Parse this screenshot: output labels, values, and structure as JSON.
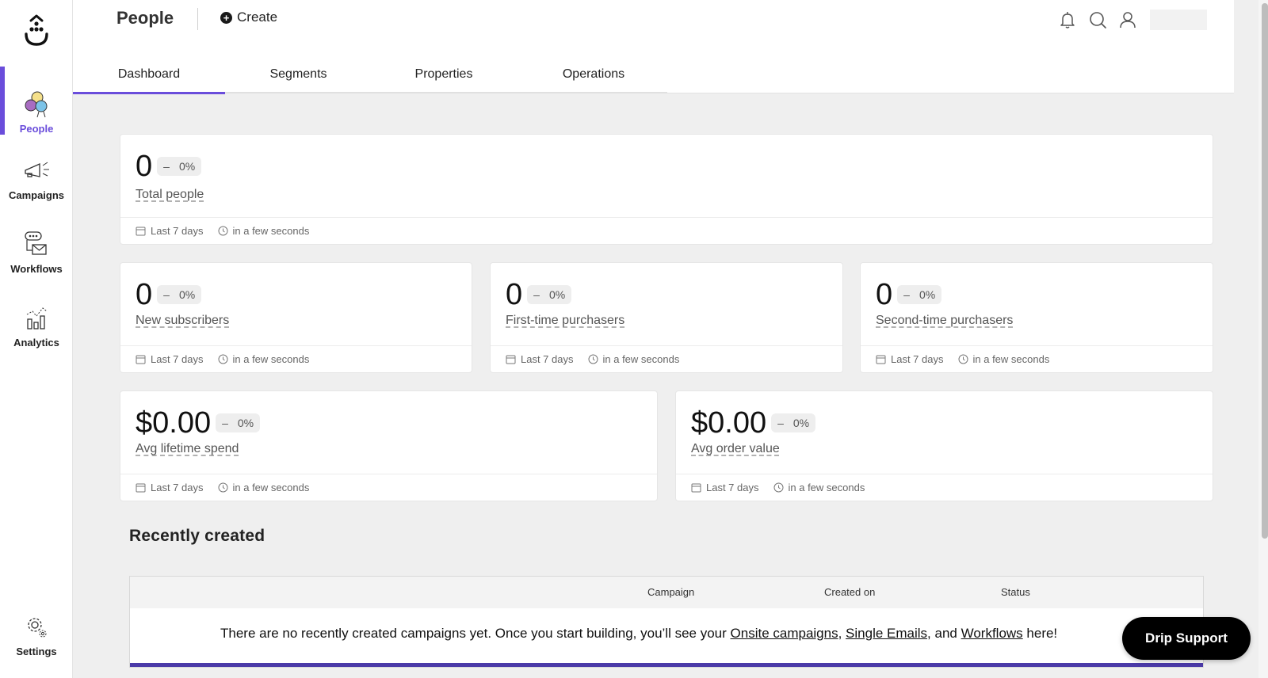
{
  "app": {
    "brand_color": "#6a4ddb",
    "page_title": "People",
    "create_label": "Create"
  },
  "sidebar": {
    "items": [
      {
        "label": "People",
        "icon": "people-icon",
        "active": true
      },
      {
        "label": "Campaigns",
        "icon": "megaphone-icon",
        "active": false
      },
      {
        "label": "Workflows",
        "icon": "workflow-icon",
        "active": false
      },
      {
        "label": "Analytics",
        "icon": "analytics-icon",
        "active": false
      },
      {
        "label": "Settings",
        "icon": "gear-icon",
        "active": false
      }
    ]
  },
  "header": {
    "icons": [
      "bell-icon",
      "search-icon",
      "user-icon"
    ]
  },
  "tabs": [
    {
      "label": "Dashboard",
      "active": true
    },
    {
      "label": "Segments",
      "active": false
    },
    {
      "label": "Properties",
      "active": false
    },
    {
      "label": "Operations",
      "active": false
    }
  ],
  "metrics": [
    {
      "value": "0",
      "delta_sign": "–",
      "delta": "0%",
      "label": "Total people",
      "range": "Last 7 days",
      "updated": "in a few seconds"
    },
    {
      "value": "0",
      "delta_sign": "–",
      "delta": "0%",
      "label": "New subscribers",
      "range": "Last 7 days",
      "updated": "in a few seconds"
    },
    {
      "value": "0",
      "delta_sign": "–",
      "delta": "0%",
      "label": "First-time purchasers",
      "range": "Last 7 days",
      "updated": "in a few seconds"
    },
    {
      "value": "0",
      "delta_sign": "–",
      "delta": "0%",
      "label": "Second-time purchasers",
      "range": "Last 7 days",
      "updated": "in a few seconds"
    },
    {
      "value": "$0.00",
      "delta_sign": "–",
      "delta": "0%",
      "label": "Avg lifetime spend",
      "range": "Last 7 days",
      "updated": "in a few seconds"
    },
    {
      "value": "$0.00",
      "delta_sign": "–",
      "delta": "0%",
      "label": "Avg order value",
      "range": "Last 7 days",
      "updated": "in a few seconds"
    }
  ],
  "recently_created": {
    "title": "Recently created",
    "columns": [
      "Campaign",
      "Created on",
      "Status"
    ],
    "empty_prefix": "There are no recently created campaigns yet. Once you start building, you’ll see your ",
    "link_onsite": "Onsite campaigns",
    "sep1": ", ",
    "link_single": "Single Emails",
    "sep2": ", and ",
    "link_workflows": "Workflows",
    "empty_suffix": " here!"
  },
  "support": {
    "label": "Drip Support"
  }
}
